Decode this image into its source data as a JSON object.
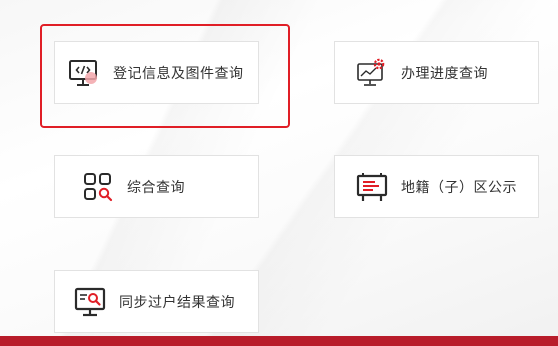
{
  "cards": {
    "register": {
      "label": "登记信息及图件查询",
      "icon": "monitor-code-icon"
    },
    "progress": {
      "label": "办理进度查询",
      "icon": "monitor-gear-chart-icon"
    },
    "combined": {
      "label": "综合查询",
      "icon": "grid-search-icon"
    },
    "cadastral": {
      "label": "地籍（子）区公示",
      "icon": "notice-board-icon"
    },
    "sync": {
      "label": "同步过户结果查询",
      "icon": "monitor-search-icon"
    }
  },
  "colors": {
    "accent": "#e01e26",
    "icon_dark": "#2b2b2b",
    "icon_pink": "#f2a6aa",
    "bottom_bar": "#b81c2a"
  }
}
